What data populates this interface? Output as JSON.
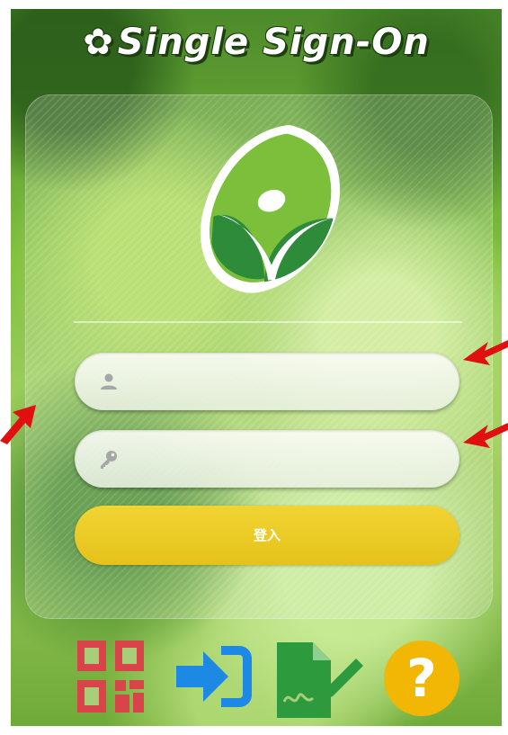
{
  "header": {
    "title": "Single Sign-On",
    "gear_icon": "gear-icon"
  },
  "logo": {
    "icon": "leaf-person-logo",
    "colors": {
      "green_light": "#8bc53f",
      "green_dark": "#2e8b3a"
    }
  },
  "form": {
    "username": {
      "placeholder": "",
      "value": "",
      "icon": "user-icon"
    },
    "password": {
      "placeholder": "",
      "value": "",
      "icon": "key-icon"
    },
    "login_label": "登入"
  },
  "bottom_bar": {
    "items": [
      {
        "icon": "qr-code-icon",
        "color": "#d9434a"
      },
      {
        "icon": "sign-in-icon",
        "color": "#1e88e5"
      },
      {
        "icon": "document-sign-icon",
        "color": "#2e9a3e"
      },
      {
        "icon": "help-icon",
        "color": "#f2b705"
      }
    ]
  },
  "annotations": {
    "arrow_color": "#e01010"
  }
}
